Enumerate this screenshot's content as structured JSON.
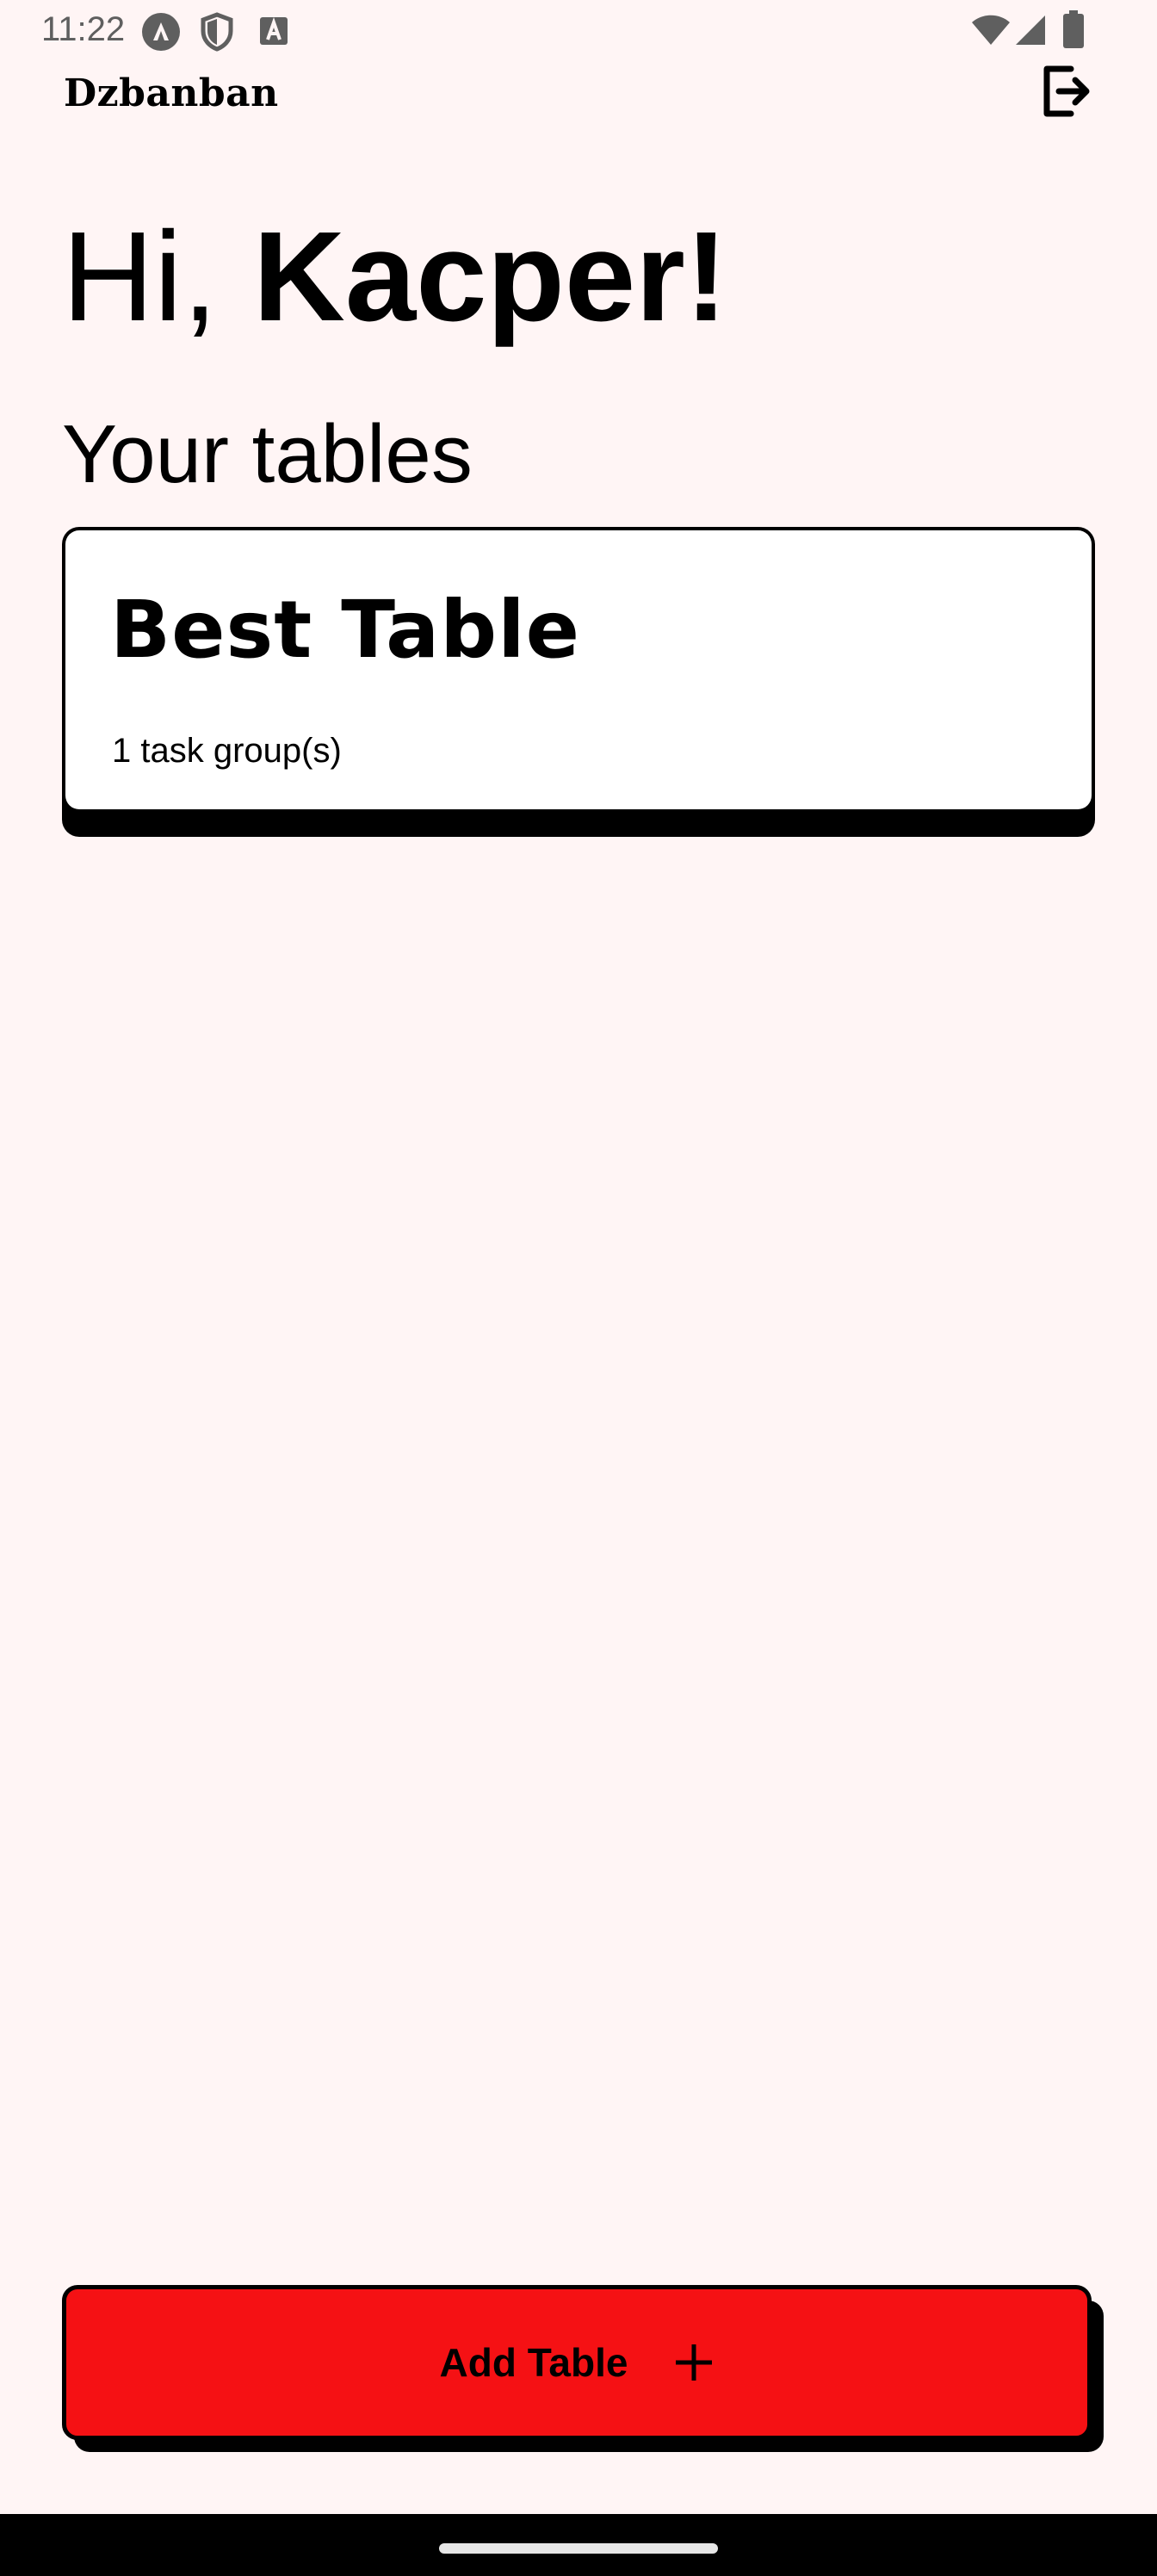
{
  "status_bar": {
    "time": "11:22",
    "icons": [
      "app-notification-icon",
      "shield-icon",
      "keyboard-indicator-icon",
      "wifi-icon",
      "cellular-signal-icon",
      "battery-icon"
    ]
  },
  "app_bar": {
    "title": "Dzbanban",
    "logout_icon": "logout-icon"
  },
  "greeting": {
    "prefix": "Hi, ",
    "name": "Kacper!"
  },
  "section_title": "Your tables",
  "tables": [
    {
      "title": "Best Table",
      "subtitle": "1 task group(s)"
    }
  ],
  "add_button": {
    "label": "Add Table",
    "icon": "plus-icon",
    "color": "#f51114"
  },
  "colors": {
    "background": "#fff5f5",
    "accent": "#f51114",
    "text": "#000000"
  }
}
